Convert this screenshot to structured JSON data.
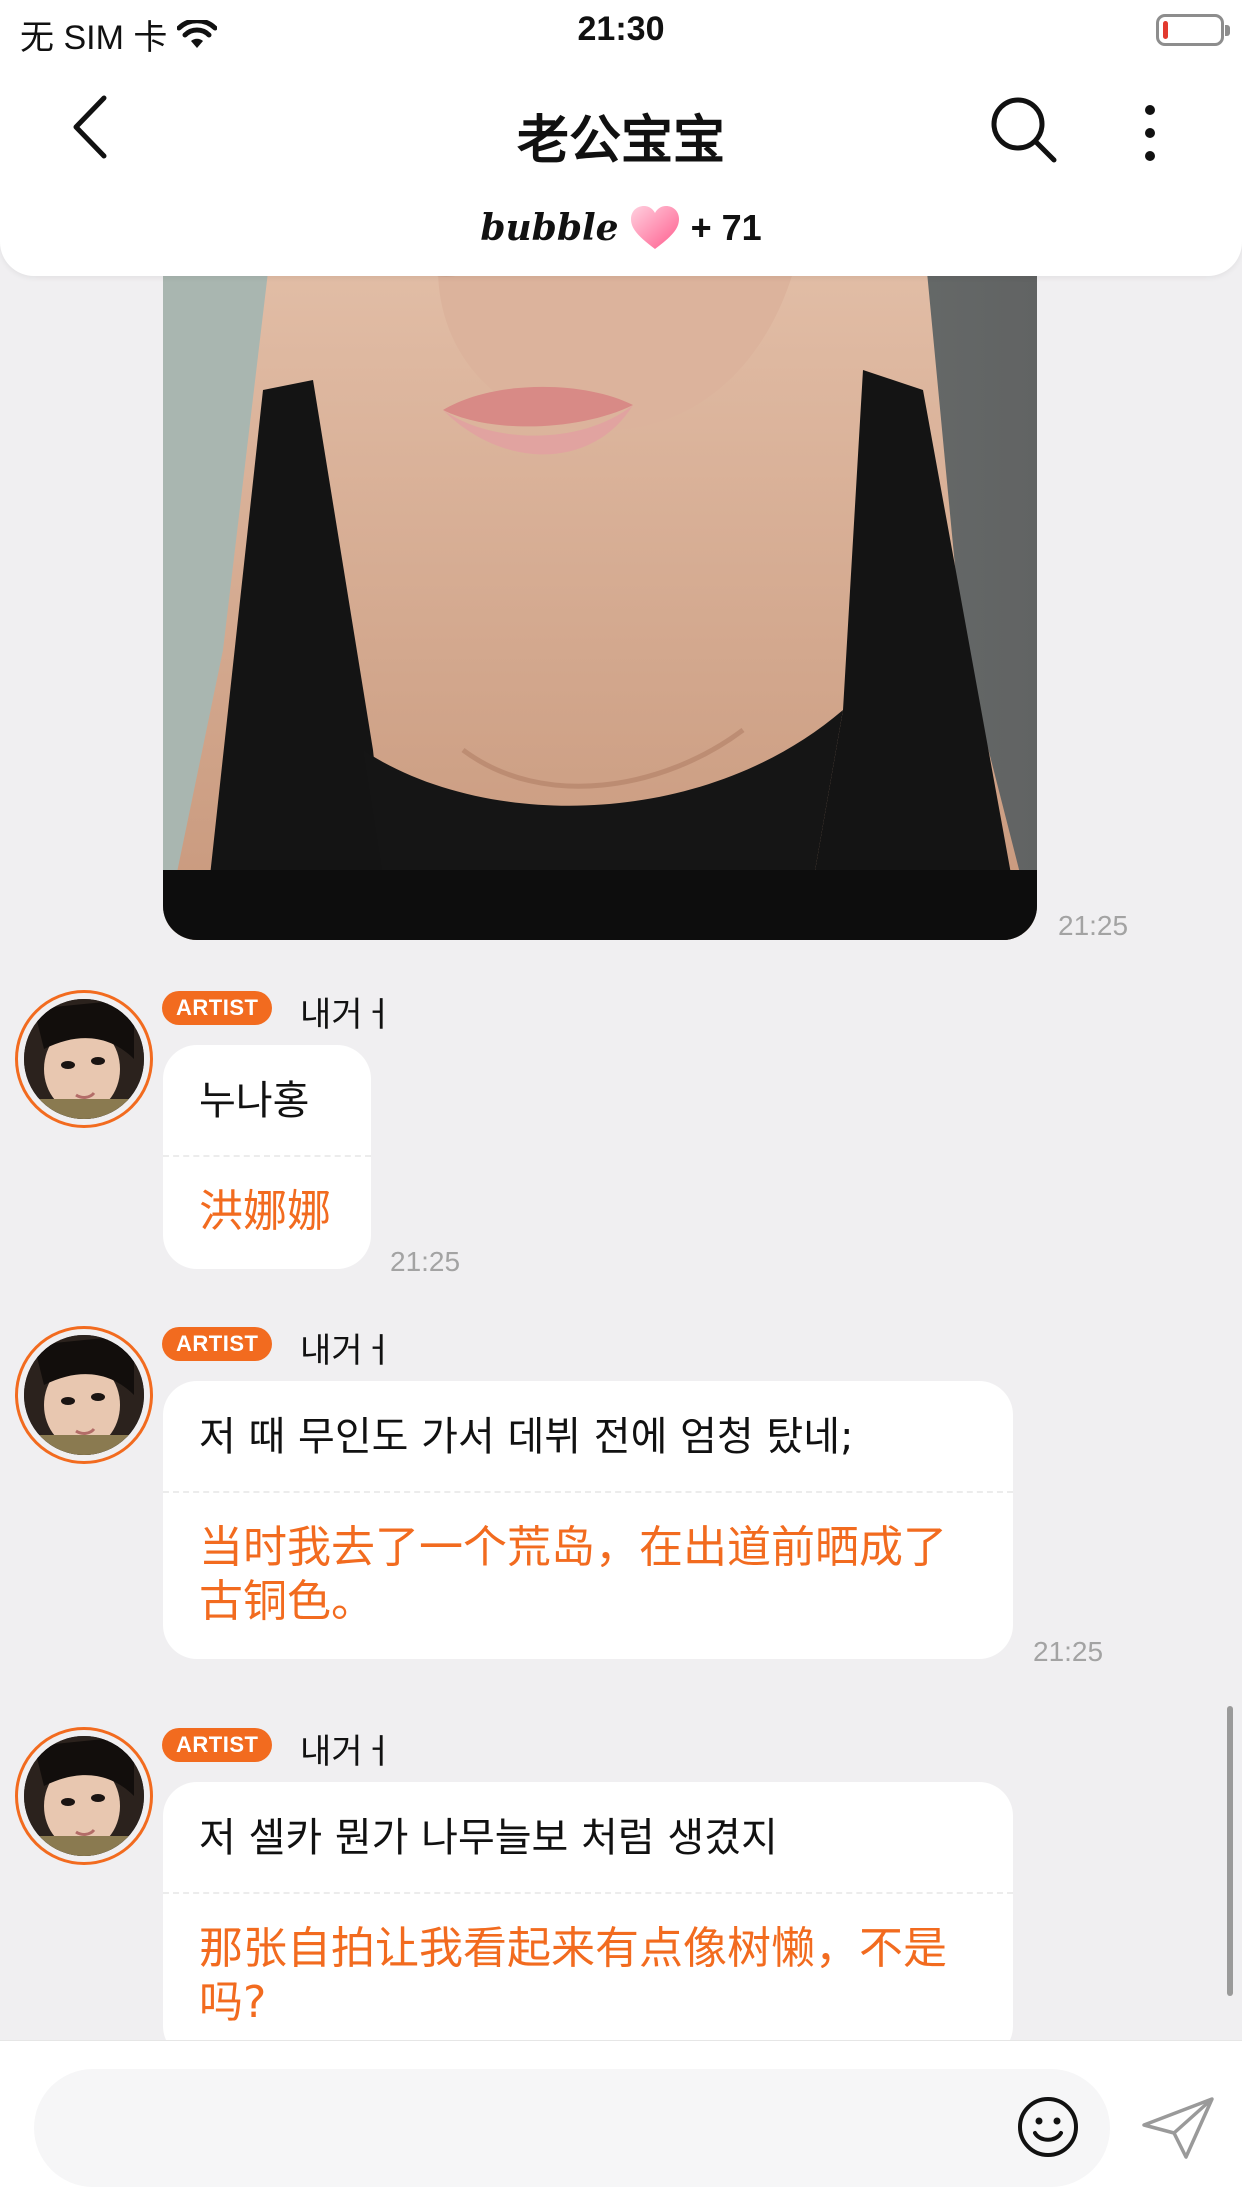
{
  "status_bar": {
    "carrier": "无 SIM 卡",
    "time": "21:30",
    "battery_level": 0.1
  },
  "header": {
    "title": "老公宝宝",
    "bubble_logo": "bubble",
    "bubble_count": "+ 71"
  },
  "photo_time": "21:25",
  "messages": [
    {
      "badge": "ARTIST",
      "sender": "내거ㅓ",
      "korean": "누나홍",
      "chinese": "洪娜娜",
      "time": "21:25"
    },
    {
      "badge": "ARTIST",
      "sender": "내거ㅓ",
      "korean": "저 때 무인도 가서 데뷔 전에 엄청 탔네;",
      "chinese": "当时我去了一个荒岛，在出道前晒成了古铜色。",
      "time": "21:25"
    },
    {
      "badge": "ARTIST",
      "sender": "내거ㅓ",
      "korean": "저 셀카 뭔가 나무늘보 처럼 생겼지",
      "chinese": "那张自拍让我看起来有点像树懒，不是吗?"
    }
  ],
  "input": {
    "value": "",
    "placeholder": ""
  },
  "icons": {
    "back": "back-chevron-icon",
    "search": "search-icon",
    "more": "more-vertical-icon",
    "heart": "heart-icon",
    "wifi": "wifi-icon",
    "battery": "battery-icon",
    "emoji": "emoji-icon",
    "send": "send-icon"
  },
  "colors": {
    "accent": "#f26b1f",
    "background": "#f0eff1",
    "bubble": "#ffffff",
    "battery_low": "#e23a2f"
  }
}
